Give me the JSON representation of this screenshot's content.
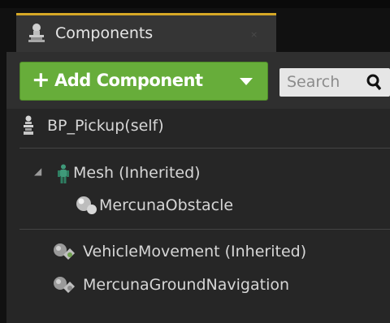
{
  "tab": {
    "title": "Components",
    "icon": "components-icon",
    "close": "×"
  },
  "toolbar": {
    "add_plus": "+",
    "add_label": "Add Component",
    "search_placeholder": "Search"
  },
  "tree": {
    "root": {
      "label": "BP_Pickup(self)",
      "icon": "blueprint-actor-icon"
    },
    "mesh": {
      "label": "Mesh (Inherited)",
      "icon": "skeletal-mesh-icon",
      "expand": "◢"
    },
    "obstacle": {
      "label": "MercunaObstacle",
      "icon": "component-sphere-icon"
    },
    "vehicle": {
      "label": "VehicleMovement (Inherited)",
      "icon": "actor-component-icon"
    },
    "navigation": {
      "label": "MercunaGroundNavigation",
      "icon": "actor-component-icon"
    }
  },
  "colors": {
    "add_button": "#67ad3a",
    "tab_accent": "#d6a826",
    "panel_bg": "#262626"
  }
}
